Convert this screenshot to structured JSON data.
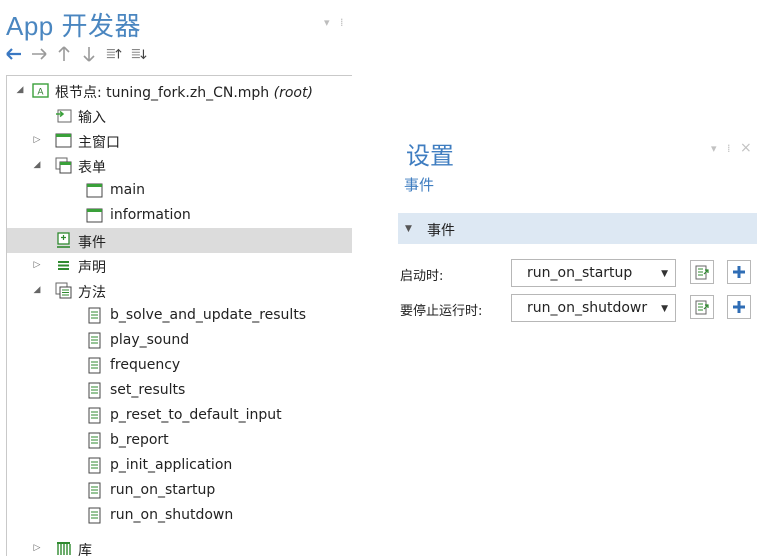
{
  "app_builder": {
    "title": "App 开发器",
    "toolbar": {
      "icons": [
        "arrow-left-icon",
        "arrow-right-icon",
        "arrow-up-icon",
        "arrow-down-icon",
        "sort-ascending-icon",
        "sort-descending-icon"
      ]
    },
    "tree": {
      "root": {
        "label": "根节点: tuning_fork.zh_CN.mph",
        "suffix": "(root)"
      },
      "input": "输入",
      "main_window": "主窗口",
      "forms": "表单",
      "form_main": "main",
      "form_information": "information",
      "events": "事件",
      "declarations": "声明",
      "methods": "方法",
      "method_items": [
        "b_solve_and_update_results",
        "play_sound",
        "frequency",
        "set_results",
        "p_reset_to_default_input",
        "b_report",
        "p_init_application",
        "run_on_startup",
        "run_on_shutdown"
      ],
      "libraries": "库"
    }
  },
  "settings": {
    "title": "设置",
    "subtitle": "事件",
    "section": "事件",
    "fields": [
      {
        "label": "启动时:",
        "value": "run_on_startup"
      },
      {
        "label": "要停止运行时:",
        "value": "run_on_shutdowr"
      }
    ]
  },
  "colors": {
    "title_blue": "#4a86c0",
    "selected_row": "#dcdcdc",
    "section_bar": "#dde8f3",
    "add_button_blue": "#2f6db5"
  }
}
